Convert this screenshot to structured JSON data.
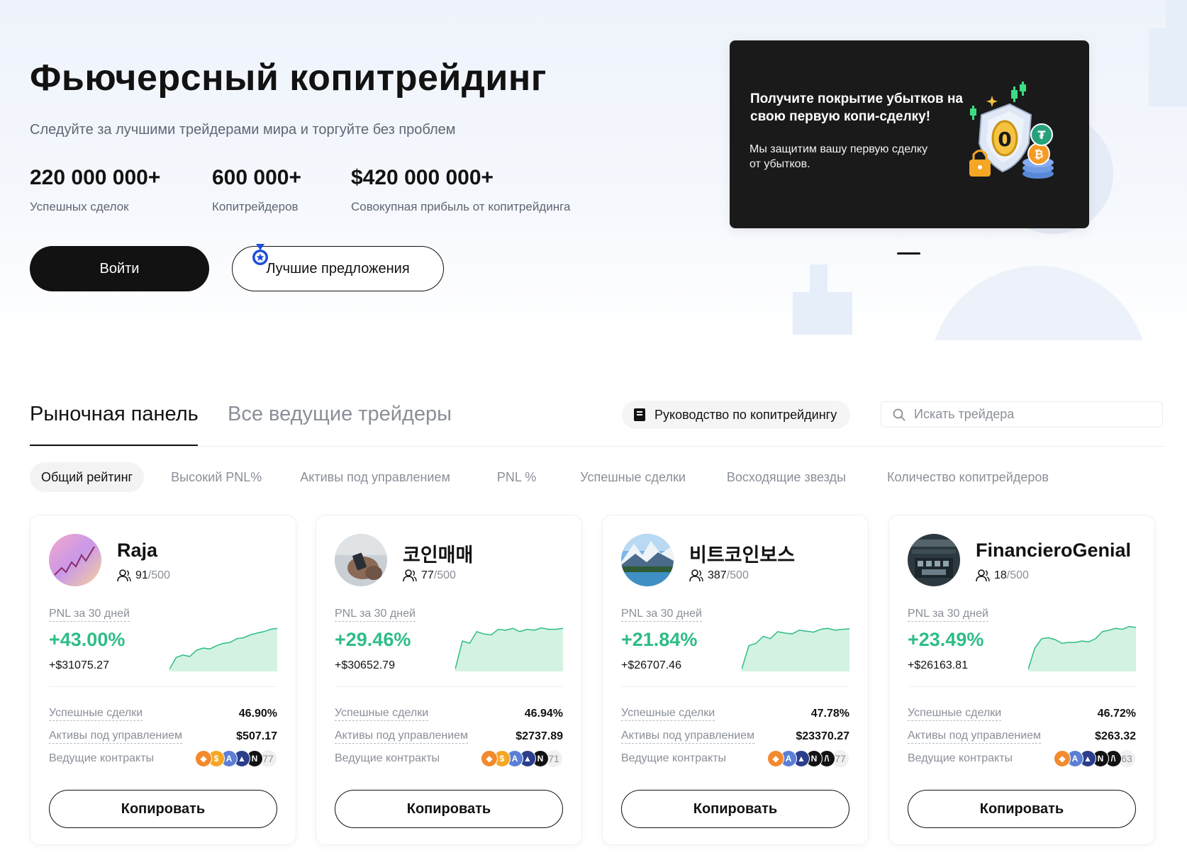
{
  "hero": {
    "title": "Фьючерсный копитрейдинг",
    "subtitle": "Следуйте за лучшими трейдерами мира и торгуйте без проблем",
    "stats": [
      {
        "value": "220 000 000+",
        "label": "Успешных сделок"
      },
      {
        "value": "600 000+",
        "label": "Копитрейдеров"
      },
      {
        "value": "$420 000 000+",
        "label": "Совокупная прибыль от копитрейдинга"
      }
    ],
    "login_label": "Войти",
    "offers_label": "Лучшие предложения"
  },
  "banner": {
    "title": "Получите покрытие убытков на свою первую копи-сделку!",
    "description": "Мы защитим вашу первую сделку от убытков."
  },
  "tabs": {
    "market_panel": "Рыночная панель",
    "all_traders": "Все ведущие трейдеры"
  },
  "guide_label": "Руководство по копитрейдингу",
  "search": {
    "placeholder": "Искать трейдера"
  },
  "filters": [
    "Общий рейтинг",
    "Высокий PNL%",
    "Активы под управлением",
    "PNL %",
    "Успешные сделки",
    "Восходящие звезды",
    "Количество копитрейдеров"
  ],
  "card_labels": {
    "pnl": "PNL за 30 дней",
    "win_rate": "Успешные сделки",
    "aum": "Активы под управлением",
    "contracts": "Ведущие контракты",
    "copy": "Копировать"
  },
  "traders": [
    {
      "name": "Raja",
      "followers": "91",
      "max": "/500",
      "pnl_pct": "+43.00%",
      "pnl_usd": "+$31075.27",
      "win_rate": "46.90%",
      "aum": "$507.17",
      "contracts_count": "77",
      "coins": [
        "shib-icon",
        "dollar-coin-icon",
        "arb-icon",
        "avax-icon",
        "near-icon"
      ],
      "spark": [
        0.05,
        0.3,
        0.35,
        0.32,
        0.45,
        0.5,
        0.48,
        0.55,
        0.6,
        0.62,
        0.7,
        0.72,
        0.78,
        0.82,
        0.85,
        0.9,
        0.92
      ]
    },
    {
      "name": "코인매매",
      "followers": "77",
      "max": "/500",
      "pnl_pct": "+29.46%",
      "pnl_usd": "+$30652.79",
      "win_rate": "46.94%",
      "aum": "$2737.89",
      "contracts_count": "71",
      "coins": [
        "shib-icon",
        "dollar-coin-icon",
        "arb-icon",
        "avax-icon",
        "near-icon"
      ],
      "spark": [
        0.05,
        0.65,
        0.6,
        0.85,
        0.8,
        0.78,
        0.9,
        0.88,
        0.92,
        0.85,
        0.9,
        0.88,
        0.93,
        0.9,
        0.9,
        0.92
      ]
    },
    {
      "name": "비트코인보스",
      "followers": "387",
      "max": "/500",
      "pnl_pct": "+21.84%",
      "pnl_usd": "+$26707.46",
      "win_rate": "47.78%",
      "aum": "$23370.27",
      "contracts_count": "77",
      "coins": [
        "shib-icon",
        "arb-icon",
        "avax-icon",
        "near-icon",
        "aptos-icon"
      ],
      "spark": [
        0.05,
        0.55,
        0.6,
        0.75,
        0.7,
        0.85,
        0.82,
        0.8,
        0.88,
        0.86,
        0.84,
        0.9,
        0.92,
        0.88,
        0.9,
        0.91
      ]
    },
    {
      "name": "FinancieroGenial",
      "followers": "18",
      "max": "/500",
      "pnl_pct": "+23.49%",
      "pnl_usd": "+$26163.81",
      "win_rate": "46.72%",
      "aum": "$263.32",
      "contracts_count": "63",
      "coins": [
        "shib-icon",
        "arb-icon",
        "avax-icon",
        "near-icon",
        "aptos-icon"
      ],
      "spark": [
        0.05,
        0.5,
        0.7,
        0.72,
        0.68,
        0.6,
        0.62,
        0.62,
        0.65,
        0.63,
        0.7,
        0.85,
        0.88,
        0.92,
        0.9,
        0.96,
        0.94
      ]
    }
  ],
  "colors": {
    "accent": "#121212",
    "positive": "#2ebd85",
    "muted": "#8a8f98"
  }
}
